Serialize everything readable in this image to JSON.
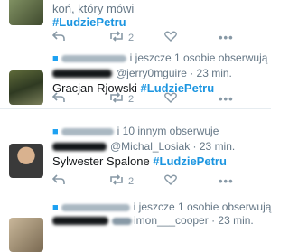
{
  "tweets": [
    {
      "text_line_1": "koń, który mówi",
      "hashtag": "#LudziePetru",
      "retweet_count": "2"
    },
    {
      "context_suffix": "i jeszcze 1 osobie obserwują",
      "handle": "@jerry0mguire",
      "handle_suffix": " · 23 min.",
      "text_prefix": "Gracjan Rjowski ",
      "hashtag": "#LudziePetru",
      "retweet_count": "2"
    },
    {
      "context_suffix": "i 10 innym obserwuje",
      "handle": "@Michal_Losiak",
      "handle_suffix": " · 23 min.",
      "text_prefix": "Sylwester Spalone ",
      "hashtag": "#LudziePetru",
      "retweet_count": "2"
    },
    {
      "context_suffix": "i jeszcze 1 osobie obserwują",
      "handle": "imon___cooper",
      "handle_suffix": " · 23 min."
    }
  ],
  "icons": {
    "reply": "reply-icon",
    "retweet": "retweet-icon",
    "like": "heart-icon",
    "more": "more-dots-icon",
    "pin": "person-icon"
  },
  "colors": {
    "hashtag": "#1b95e0",
    "meta": "#657786",
    "icon": "#8899a6",
    "divider": "#e6ecf0"
  }
}
